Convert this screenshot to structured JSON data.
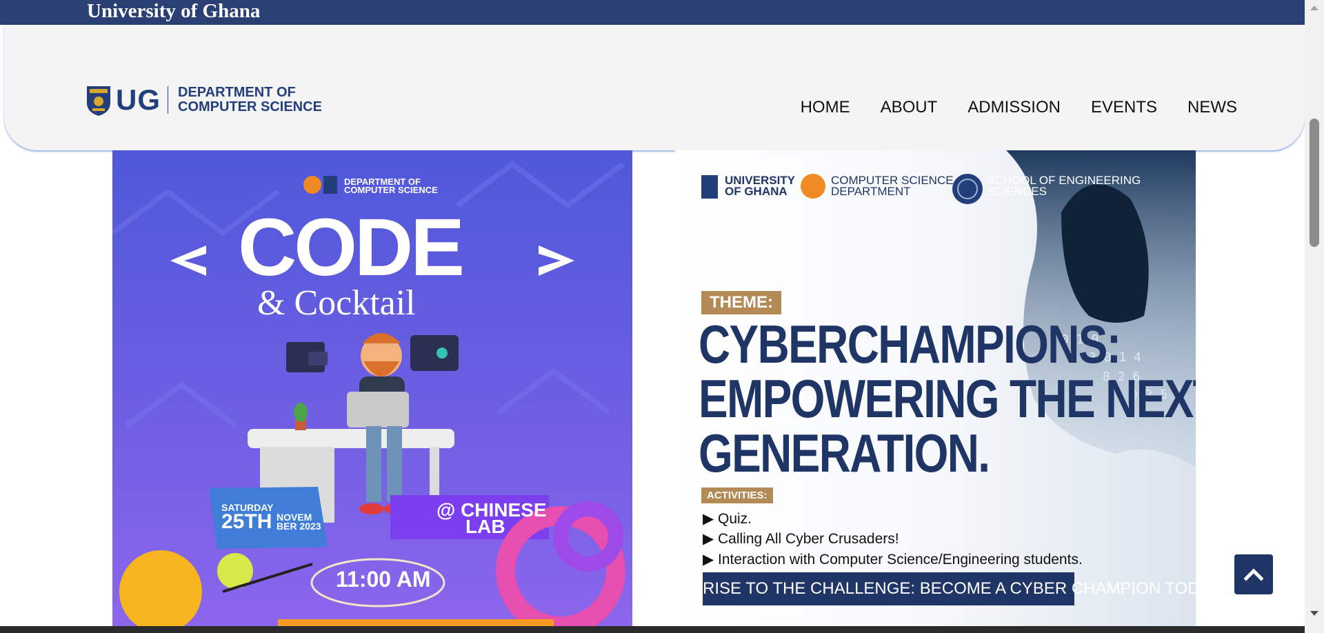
{
  "topbar": {
    "brand": "University of Ghana"
  },
  "header": {
    "logo": {
      "abbr": "UG",
      "dept_line1": "DEPARTMENT OF",
      "dept_line2": "COMPUTER SCIENCE"
    },
    "nav": [
      {
        "label": "HOME"
      },
      {
        "label": "ABOUT"
      },
      {
        "label": "ADMISSION"
      },
      {
        "label": "EVENTS"
      },
      {
        "label": "NEWS"
      }
    ]
  },
  "poster1": {
    "dept_line1": "DEPARTMENT OF",
    "dept_line2": "COMPUTER SCIENCE",
    "title": "CODE",
    "subtitle": "& Cocktail",
    "day": "SATURDAY",
    "date": "25TH",
    "month_line1": "NOVEM",
    "month_line2": "BER 2023",
    "venue_line1": "@ CHINESE",
    "venue_line2": "LAB",
    "time": "11:00 AM"
  },
  "poster2": {
    "ug_line1": "UNIVERSITY",
    "ug_line2": "OF GHANA",
    "csd_line1": "COMPUTER SCIENCE",
    "csd_line2": "DEPARTMENT",
    "soe_line1": "SCHOOL OF ENGINEERING",
    "soe_line2": "SCIENCES",
    "theme_label": "THEME:",
    "headline_line1": "CYBERCHAMPIONS:",
    "headline_line2": "EMPOWERING THE NEXT",
    "headline_line3": "GENERATION.",
    "activities_label": "ACTIVITIES:",
    "activities": [
      "▶ Quiz.",
      "▶ Calling All Cyber Crusaders!",
      "▶ Interaction with Computer Science/Engineering students."
    ],
    "cta": "RISE TO THE CHALLENGE: BECOME A CYBER CHAMPION TODAY"
  },
  "icons": {
    "scroll_top": "chevron-up-icon",
    "crest": "ug-crest-icon"
  },
  "colors": {
    "topbar": "#2a4075",
    "brand_blue": "#233f7b",
    "poster2_navy": "#1f3565",
    "gold": "#b38a55"
  }
}
